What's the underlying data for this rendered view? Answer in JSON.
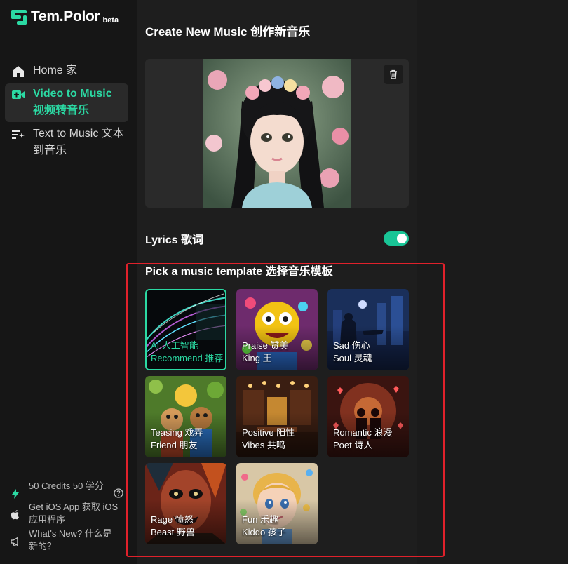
{
  "app": {
    "brand": "Tem.Polor",
    "badge": "beta",
    "accent_color": "#2bd9a3"
  },
  "sidebar": {
    "items": [
      {
        "label": "Home 家",
        "icon": "home-icon",
        "active": false
      },
      {
        "label": "Video to Music 视频转音乐",
        "icon": "video-plus-icon",
        "active": true
      },
      {
        "label": "Text to Music 文本到音乐",
        "icon": "text-sparkle-icon",
        "active": false
      }
    ],
    "bottom": [
      {
        "label": "50 Credits  50 学分",
        "icon": "lightning-icon"
      },
      {
        "label": "Get iOS App 获取 iOS 应用程序",
        "icon": "apple-icon"
      },
      {
        "label": "What's New? 什么是新的？",
        "icon": "megaphone-icon"
      }
    ]
  },
  "main": {
    "title": "Create New Music 创作新音乐",
    "lyrics_label": "Lyrics 歌词",
    "lyrics_enabled": true,
    "template_title": "Pick a music template 选择音乐模板",
    "templates": [
      {
        "line1": "AI 人工智能",
        "line2": "Recommend 推荐",
        "selected": true
      },
      {
        "line1": "Praise 赞美",
        "line2": "King 王",
        "selected": false
      },
      {
        "line1": "Sad 伤心",
        "line2": "Soul 灵魂",
        "selected": false
      },
      {
        "line1": "Teasing 戏弄",
        "line2": "Friend 朋友",
        "selected": false
      },
      {
        "line1": "Positive 阳性",
        "line2": "Vibes 共鸣",
        "selected": false
      },
      {
        "line1": "Romantic 浪漫",
        "line2": "Poet 诗人",
        "selected": false
      },
      {
        "line1": "Rage 愤怒",
        "line2": "Beast 野兽",
        "selected": false
      },
      {
        "line1": "Fun 乐趣",
        "line2": "Kiddo 孩子",
        "selected": false
      }
    ]
  }
}
